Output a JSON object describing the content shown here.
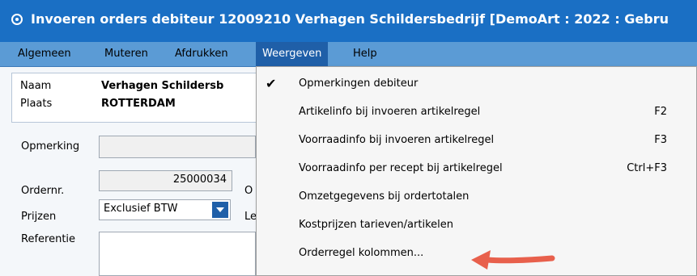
{
  "titlebar": {
    "icon": "app-gear-icon",
    "title": "Invoeren orders debiteur 12009210 Verhagen Schildersbedrijf  [DemoArt : 2022 : Gebru"
  },
  "menubar": {
    "items": [
      {
        "label": "Algemeen"
      },
      {
        "label": "Muteren"
      },
      {
        "label": "Afdrukken"
      },
      {
        "label": "Weergeven"
      },
      {
        "label": "Help"
      }
    ]
  },
  "customer": {
    "name_label": "Naam",
    "name_value": "Verhagen Schildersb",
    "city_label": "Plaats",
    "city_value": "ROTTERDAM"
  },
  "form": {
    "remark_label": "Opmerking",
    "remark_value": "",
    "ordernr_label": "Ordernr.",
    "ordernr_value": "25000034",
    "ordernr_suffix": "O",
    "prices_label": "Prijzen",
    "prices_value": "Exclusief BTW",
    "prices_suffix": "Le",
    "reference_label": "Referentie",
    "reference_value": ""
  },
  "dropdown": {
    "items": [
      {
        "label": "Opmerkingen debiteur",
        "shortcut": "",
        "checked": true
      },
      {
        "label": "Artikelinfo bij invoeren artikelregel",
        "shortcut": "F2",
        "checked": false
      },
      {
        "label": "Voorraadinfo bij invoeren artikelregel",
        "shortcut": "F3",
        "checked": false
      },
      {
        "label": "Voorraadinfo per recept bij artikelregel",
        "shortcut": "Ctrl+F3",
        "checked": false
      },
      {
        "label": "Omzetgegevens bij ordertotalen",
        "shortcut": "",
        "checked": false
      },
      {
        "label": "Kostprijzen tarieven/artikelen",
        "shortcut": "",
        "checked": false
      },
      {
        "label": "Orderregel kolommen...",
        "shortcut": "",
        "checked": false
      }
    ],
    "check_glyph": "✔"
  },
  "colors": {
    "titlebar": "#1a6fc4",
    "menubar": "#5b9bd5",
    "active_menu": "#1f5fa8",
    "annotation_arrow": "#e8604c"
  }
}
